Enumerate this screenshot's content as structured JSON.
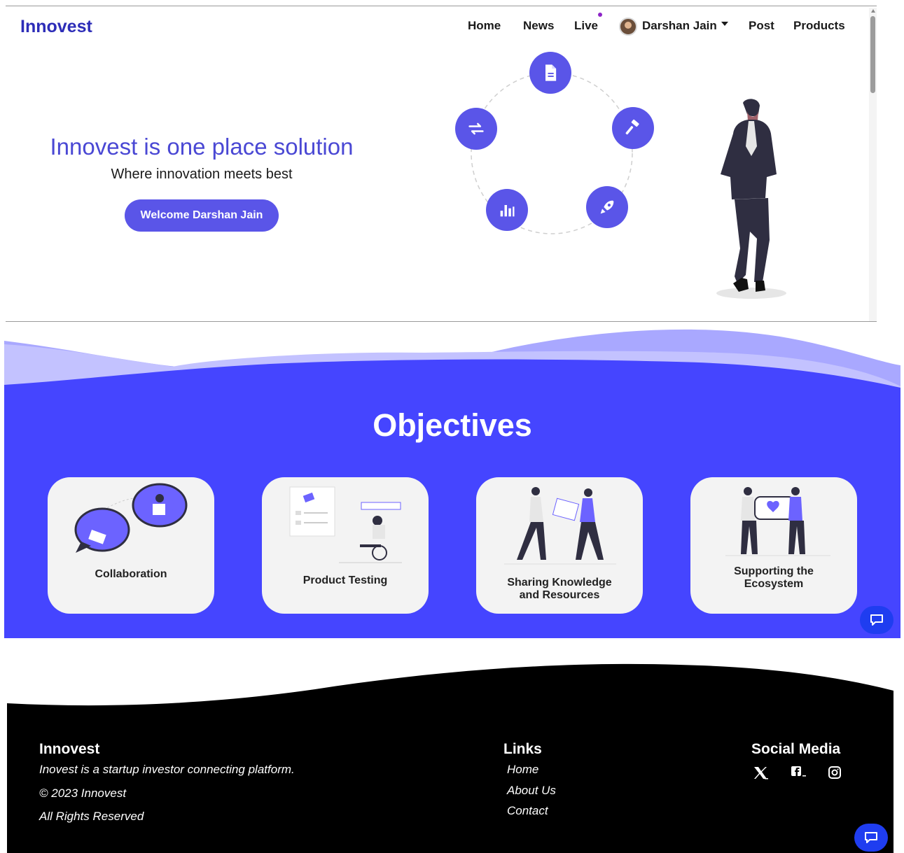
{
  "header": {
    "brand": "Innovest",
    "nav": {
      "home": "Home",
      "news": "News",
      "live": "Live",
      "user": "Darshan Jain",
      "post": "Post",
      "products": "Products"
    }
  },
  "hero": {
    "title": "Innovest is one place solution",
    "subtitle": "Where innovation meets best",
    "button": "Welcome Darshan Jain",
    "orbit_icons": [
      "document-icon",
      "hammer-icon",
      "rocket-icon",
      "bar-chart-icon",
      "swap-arrows-icon"
    ]
  },
  "objectives": {
    "title": "Objectives",
    "cards": [
      {
        "label": "Collaboration"
      },
      {
        "label": "Product Testing"
      },
      {
        "label_line1": "Sharing Knowledge",
        "label_line2": "and Resources"
      },
      {
        "label_line1": "Supporting the",
        "label_line2": "Ecosystem"
      }
    ]
  },
  "footer": {
    "brand": "Innovest",
    "tagline": "Inovest is a startup investor connecting platform.",
    "copyright": "© 2023 Innovest",
    "rights": "All Rights Reserved",
    "links_heading": "Links",
    "links": [
      "Home",
      "About Us",
      "Contact"
    ],
    "social_heading": "Social Media",
    "social": [
      "x-icon",
      "facebook-icon",
      "instagram-icon"
    ]
  },
  "colors": {
    "accent": "#5a55e8",
    "brand_text": "#2d2db8",
    "objectives_bg": "#4545ff",
    "footer_bg": "#000000",
    "chat_button": "#1f3df0"
  }
}
